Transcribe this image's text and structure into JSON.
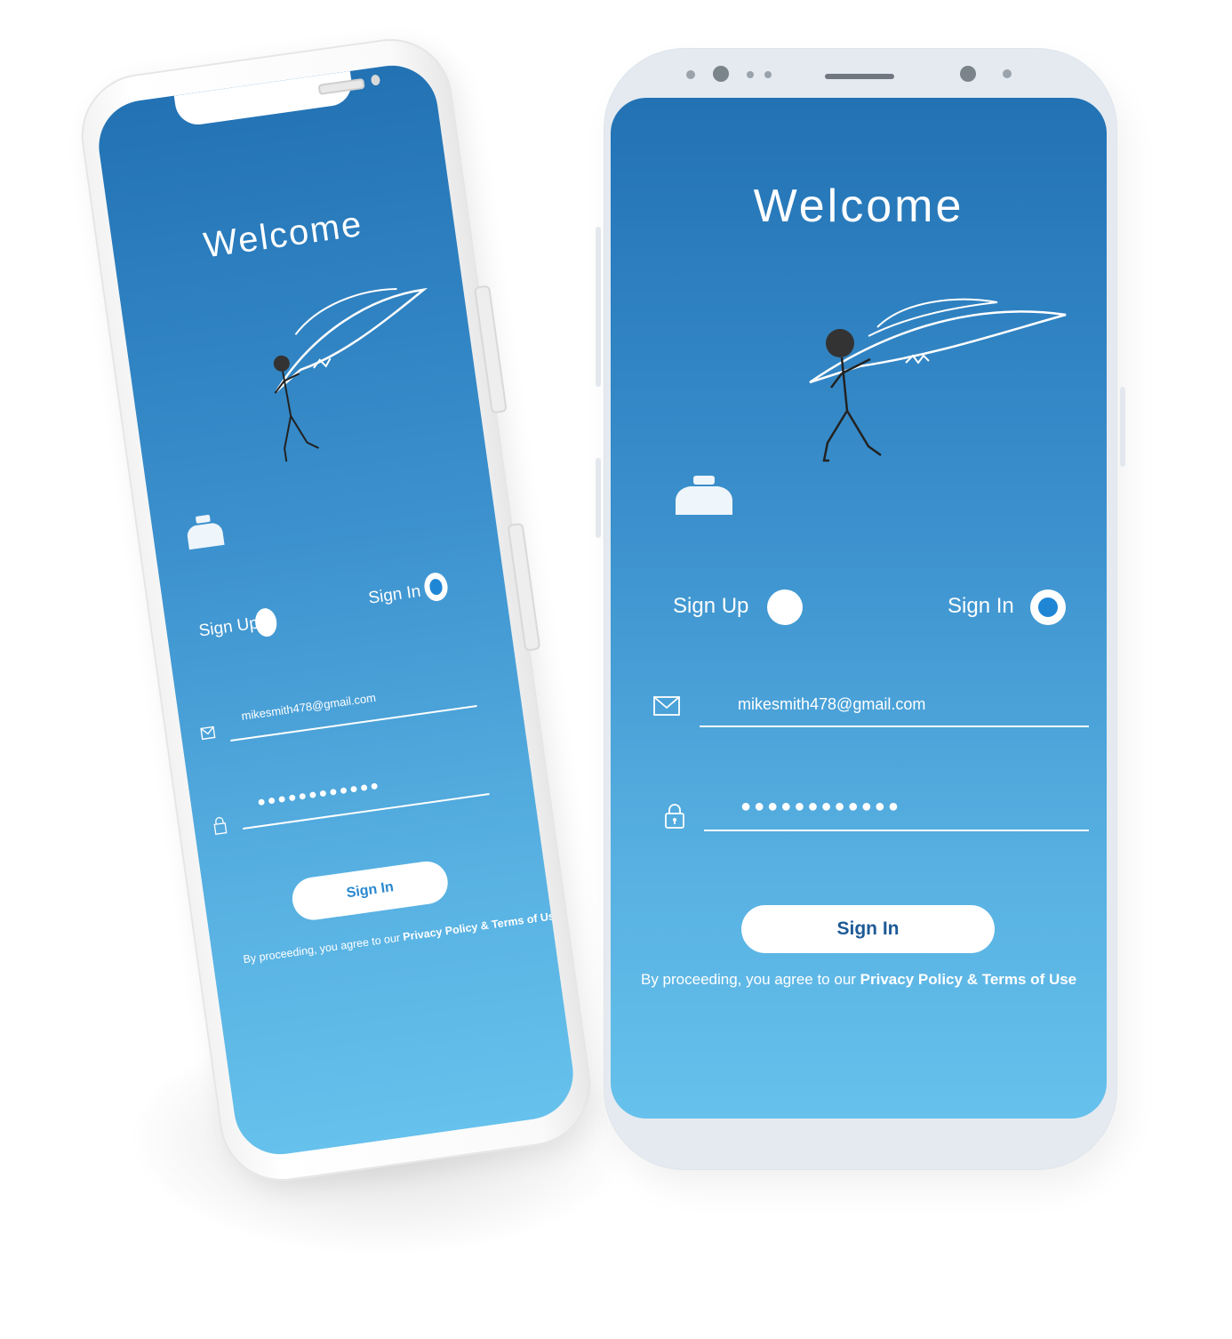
{
  "screen": {
    "welcome_title": "Welcome",
    "options": {
      "signup_label": "Sign Up",
      "signin_label": "Sign In",
      "selected": "Sign In"
    },
    "email": {
      "value": "mikesmith478@gmail.com"
    },
    "password": {
      "masked_value": "●●●●●●●●●●●●"
    },
    "button": {
      "label": "Sign In"
    },
    "terms": {
      "prefix": "By proceeding, you agree to our ",
      "link": "Privacy Policy & Terms of Use"
    }
  },
  "icons": {
    "email": "envelope-icon",
    "password": "lock-icon",
    "illustration": "stick-figure-feather-illustration",
    "inkwell": "inkwell-icon"
  },
  "colors": {
    "gradient_top": "#2272b4",
    "gradient_bottom": "#66c1ec",
    "button_text": "#1e5a97",
    "radio_selected": "#1f86d6"
  }
}
